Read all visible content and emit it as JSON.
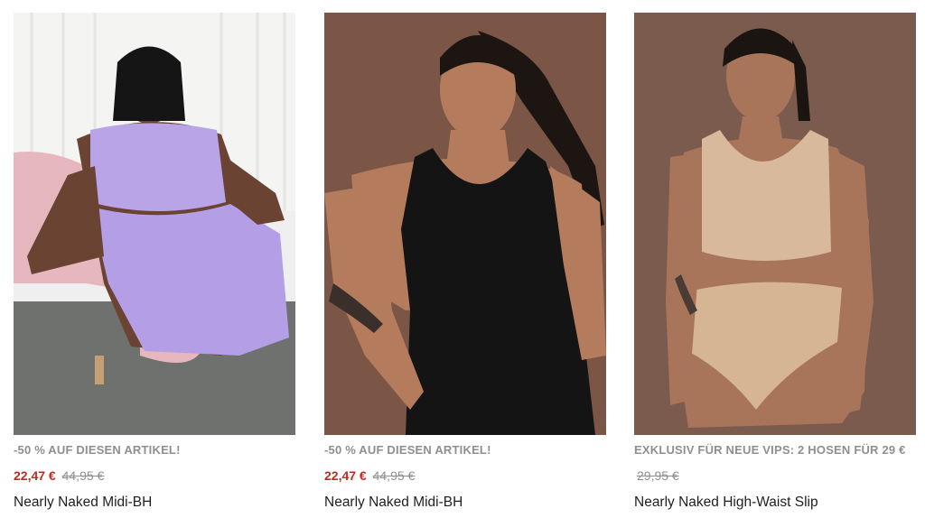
{
  "products": [
    {
      "promo": "-50 % AUF DIESEN ARTIKEL!",
      "sale_price": "22,47 €",
      "old_price": "44,95 €",
      "title": "Nearly Naked Midi-BH",
      "image_desc_color": "#b9a4e8"
    },
    {
      "promo": "-50 % AUF DIESEN ARTIKEL!",
      "sale_price": "22,47 €",
      "old_price": "44,95 €",
      "title": "Nearly Naked Midi-BH",
      "image_desc_color": "#1a1a1a"
    },
    {
      "promo": "EXKLUSIV FÜR NEUE VIPS: 2 HOSEN FÜR 29 €",
      "sale_price": "",
      "old_price": "29,95 €",
      "title": "Nearly Naked High-Waist Slip",
      "image_desc_color": "#d8b99c"
    }
  ],
  "colors": {
    "sale": "#c8271f",
    "muted": "#8f8f8f",
    "text": "#1f1f1f"
  }
}
